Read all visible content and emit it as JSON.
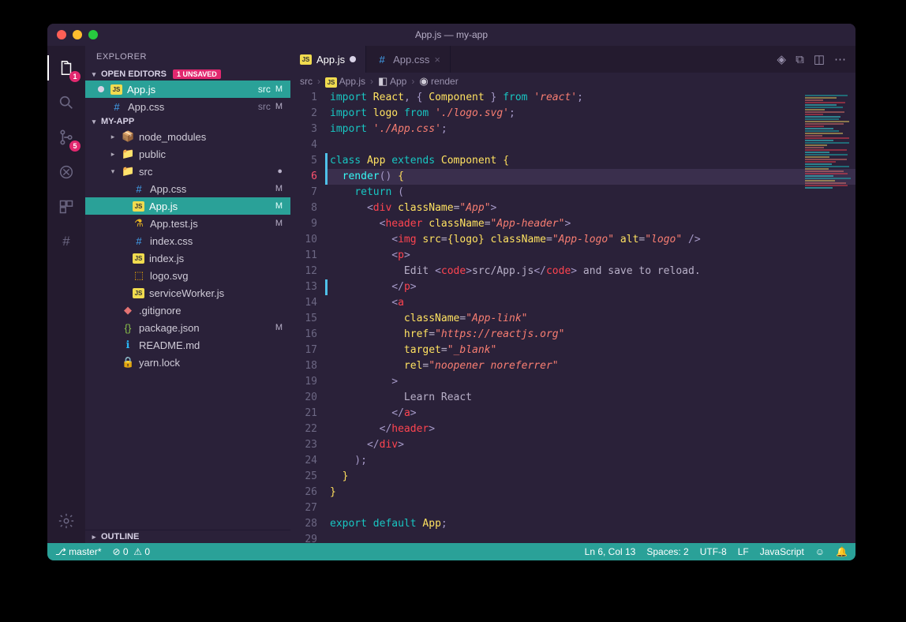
{
  "title": "App.js — my-app",
  "activitybar": {
    "explorer_badge": "1",
    "scm_badge": "5"
  },
  "sidebar": {
    "title": "EXPLORER",
    "open_editors": {
      "header": "OPEN EDITORS",
      "unsaved_pill": "1 UNSAVED"
    },
    "open_items": [
      {
        "name": "App.js",
        "sub": "src",
        "status": "M",
        "dirty": true,
        "icon": "JS",
        "sel": true
      },
      {
        "name": "App.css",
        "sub": "src",
        "status": "M",
        "dirty": false,
        "icon": "#",
        "sel": false
      }
    ],
    "project": {
      "header": "MY-APP"
    },
    "tree": [
      {
        "name": "node_modules",
        "icon": "📦",
        "indent": 1,
        "folder": true,
        "expanded": false
      },
      {
        "name": "public",
        "icon": "📁",
        "indent": 1,
        "folder": true,
        "expanded": false
      },
      {
        "name": "src",
        "icon": "📁",
        "indent": 1,
        "folder": true,
        "expanded": true,
        "status": "●"
      },
      {
        "name": "App.css",
        "icon": "#",
        "indent": 2,
        "status": "M"
      },
      {
        "name": "App.js",
        "icon": "JS",
        "indent": 2,
        "status": "M",
        "sel": true
      },
      {
        "name": "App.test.js",
        "icon": "⚗",
        "indent": 2,
        "status": "M"
      },
      {
        "name": "index.css",
        "icon": "#",
        "indent": 2
      },
      {
        "name": "index.js",
        "icon": "JS",
        "indent": 2
      },
      {
        "name": "logo.svg",
        "icon": "⬚",
        "indent": 2
      },
      {
        "name": "serviceWorker.js",
        "icon": "JS",
        "indent": 2
      },
      {
        "name": ".gitignore",
        "icon": "◆",
        "indent": 1
      },
      {
        "name": "package.json",
        "icon": "{}",
        "indent": 1,
        "status": "M"
      },
      {
        "name": "README.md",
        "icon": "ℹ",
        "indent": 1
      },
      {
        "name": "yarn.lock",
        "icon": "🔒",
        "indent": 1
      }
    ],
    "outline": {
      "header": "OUTLINE"
    }
  },
  "tabs": [
    {
      "name": "App.js",
      "icon": "JS",
      "dirty": true,
      "active": true
    },
    {
      "name": "App.css",
      "icon": "#",
      "dirty": false,
      "active": false
    }
  ],
  "breadcrumb": [
    "src",
    "App.js",
    "App",
    "render"
  ],
  "gutter": {
    "lines": 29,
    "highlight": 6,
    "modified": [
      5,
      6,
      13
    ]
  },
  "code": [
    [
      {
        "t": "import ",
        "c": "kw"
      },
      {
        "t": "React",
        "c": "cls"
      },
      {
        "t": ", { ",
        "c": "pn"
      },
      {
        "t": "Component",
        "c": "cls"
      },
      {
        "t": " } ",
        "c": "pn"
      },
      {
        "t": "from ",
        "c": "kw"
      },
      {
        "t": "'react'",
        "c": "str"
      },
      {
        "t": ";",
        "c": "pn"
      }
    ],
    [
      {
        "t": "import ",
        "c": "kw"
      },
      {
        "t": "logo ",
        "c": "cls"
      },
      {
        "t": "from ",
        "c": "kw"
      },
      {
        "t": "'./logo.svg'",
        "c": "str"
      },
      {
        "t": ";",
        "c": "pn"
      }
    ],
    [
      {
        "t": "import ",
        "c": "kw"
      },
      {
        "t": "'./App.css'",
        "c": "str"
      },
      {
        "t": ";",
        "c": "pn"
      }
    ],
    [],
    [
      {
        "t": "class ",
        "c": "kw"
      },
      {
        "t": "App ",
        "c": "cls"
      },
      {
        "t": "extends ",
        "c": "kw"
      },
      {
        "t": "Component ",
        "c": "cls"
      },
      {
        "t": "{",
        "c": "br"
      }
    ],
    [
      {
        "t": "  ",
        "c": ""
      },
      {
        "t": "render",
        "c": "fn"
      },
      {
        "t": "() ",
        "c": "pn"
      },
      {
        "t": "{",
        "c": "br"
      }
    ],
    [
      {
        "t": "    ",
        "c": ""
      },
      {
        "t": "return ",
        "c": "kw"
      },
      {
        "t": "(",
        "c": "pn"
      }
    ],
    [
      {
        "t": "      ",
        "c": ""
      },
      {
        "t": "<",
        "c": "pn"
      },
      {
        "t": "div ",
        "c": "tag"
      },
      {
        "t": "className",
        "c": "attr"
      },
      {
        "t": "=",
        "c": "op"
      },
      {
        "t": "\"App\"",
        "c": "str"
      },
      {
        "t": ">",
        "c": "pn"
      }
    ],
    [
      {
        "t": "        ",
        "c": ""
      },
      {
        "t": "<",
        "c": "pn"
      },
      {
        "t": "header ",
        "c": "tag"
      },
      {
        "t": "className",
        "c": "attr"
      },
      {
        "t": "=",
        "c": "op"
      },
      {
        "t": "\"App-header\"",
        "c": "str"
      },
      {
        "t": ">",
        "c": "pn"
      }
    ],
    [
      {
        "t": "          ",
        "c": ""
      },
      {
        "t": "<",
        "c": "pn"
      },
      {
        "t": "img ",
        "c": "tag"
      },
      {
        "t": "src",
        "c": "attr"
      },
      {
        "t": "=",
        "c": "op"
      },
      {
        "t": "{",
        "c": "br"
      },
      {
        "t": "logo",
        "c": "cls"
      },
      {
        "t": "}",
        "c": "br"
      },
      {
        "t": " className",
        "c": "attr"
      },
      {
        "t": "=",
        "c": "op"
      },
      {
        "t": "\"App-logo\"",
        "c": "str"
      },
      {
        "t": " alt",
        "c": "attr"
      },
      {
        "t": "=",
        "c": "op"
      },
      {
        "t": "\"logo\"",
        "c": "str"
      },
      {
        "t": " />",
        "c": "pn"
      }
    ],
    [
      {
        "t": "          ",
        "c": ""
      },
      {
        "t": "<",
        "c": "pn"
      },
      {
        "t": "p",
        "c": "tag"
      },
      {
        "t": ">",
        "c": "pn"
      }
    ],
    [
      {
        "t": "            Edit ",
        "c": "op"
      },
      {
        "t": "<",
        "c": "pn"
      },
      {
        "t": "code",
        "c": "tag"
      },
      {
        "t": ">",
        "c": "pn"
      },
      {
        "t": "src/App.js",
        "c": "op"
      },
      {
        "t": "</",
        "c": "pn"
      },
      {
        "t": "code",
        "c": "tag"
      },
      {
        "t": ">",
        "c": "pn"
      },
      {
        "t": " and save to reload.",
        "c": "op"
      }
    ],
    [
      {
        "t": "          ",
        "c": ""
      },
      {
        "t": "</",
        "c": "pn"
      },
      {
        "t": "p",
        "c": "tag"
      },
      {
        "t": ">",
        "c": "pn"
      }
    ],
    [
      {
        "t": "          ",
        "c": ""
      },
      {
        "t": "<",
        "c": "pn"
      },
      {
        "t": "a",
        "c": "tag"
      }
    ],
    [
      {
        "t": "            ",
        "c": ""
      },
      {
        "t": "className",
        "c": "attr"
      },
      {
        "t": "=",
        "c": "op"
      },
      {
        "t": "\"App-link\"",
        "c": "str"
      }
    ],
    [
      {
        "t": "            ",
        "c": ""
      },
      {
        "t": "href",
        "c": "attr"
      },
      {
        "t": "=",
        "c": "op"
      },
      {
        "t": "\"https://reactjs.org\"",
        "c": "str"
      }
    ],
    [
      {
        "t": "            ",
        "c": ""
      },
      {
        "t": "target",
        "c": "attr"
      },
      {
        "t": "=",
        "c": "op"
      },
      {
        "t": "\"_blank\"",
        "c": "str"
      }
    ],
    [
      {
        "t": "            ",
        "c": ""
      },
      {
        "t": "rel",
        "c": "attr"
      },
      {
        "t": "=",
        "c": "op"
      },
      {
        "t": "\"noopener noreferrer\"",
        "c": "str"
      }
    ],
    [
      {
        "t": "          ",
        "c": ""
      },
      {
        "t": ">",
        "c": "pn"
      }
    ],
    [
      {
        "t": "            Learn React",
        "c": "op"
      }
    ],
    [
      {
        "t": "          ",
        "c": ""
      },
      {
        "t": "</",
        "c": "pn"
      },
      {
        "t": "a",
        "c": "tag"
      },
      {
        "t": ">",
        "c": "pn"
      }
    ],
    [
      {
        "t": "        ",
        "c": ""
      },
      {
        "t": "</",
        "c": "pn"
      },
      {
        "t": "header",
        "c": "tag"
      },
      {
        "t": ">",
        "c": "pn"
      }
    ],
    [
      {
        "t": "      ",
        "c": ""
      },
      {
        "t": "</",
        "c": "pn"
      },
      {
        "t": "div",
        "c": "tag"
      },
      {
        "t": ">",
        "c": "pn"
      }
    ],
    [
      {
        "t": "    );",
        "c": "pn"
      }
    ],
    [
      {
        "t": "  ",
        "c": ""
      },
      {
        "t": "}",
        "c": "br"
      }
    ],
    [
      {
        "t": "}",
        "c": "br"
      }
    ],
    [],
    [
      {
        "t": "export ",
        "c": "kw"
      },
      {
        "t": "default ",
        "c": "kw"
      },
      {
        "t": "App",
        "c": "cls"
      },
      {
        "t": ";",
        "c": "pn"
      }
    ],
    []
  ],
  "statusbar": {
    "branch": "master*",
    "errors": "0",
    "warnings": "0",
    "position": "Ln 6, Col 13",
    "spaces": "Spaces: 2",
    "encoding": "UTF-8",
    "eol": "LF",
    "lang": "JavaScript"
  },
  "icon_color": {
    "JS": "#f0db4f",
    "#": "#42a5f5",
    "⚗": "#e6b422",
    "⬚": "#ffb300",
    "{}": "#8bc34a",
    "ℹ": "#29b6f6",
    "🔒": "#90a4ae",
    "◆": "#e57373",
    "📦": "#8bc34a",
    "📁": "#42a5f5"
  }
}
